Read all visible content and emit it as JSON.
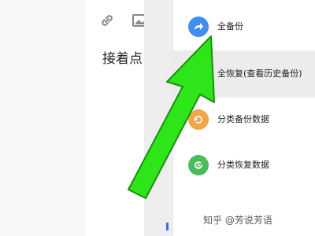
{
  "editor": {
    "text": "接着点"
  },
  "menu": {
    "items": [
      {
        "label": "全备份",
        "icon": "share-arrow-icon",
        "color": "#3f8ef0"
      },
      {
        "label": "全恢复(查看历史备份)",
        "icon": "restore-icon",
        "color": "#3f8ef0"
      },
      {
        "label": "分类备份数据",
        "icon": "category-backup-icon",
        "color": "#f2a648"
      },
      {
        "label": "分类恢复数据",
        "icon": "category-restore-icon",
        "color": "#4cbb5d"
      }
    ]
  },
  "watermark": "知乎 @芳说芳语",
  "colors": {
    "arrow": "#2ee51a",
    "arrow_outline": "#1a8f10"
  }
}
